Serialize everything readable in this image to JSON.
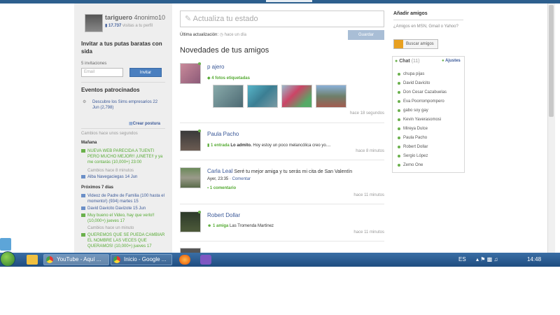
{
  "profile": {
    "name_left": "tariguero",
    "name_right": "4nonimo10",
    "visits_count": "17.737",
    "visits_label": "visitas a tu perfil"
  },
  "invite": {
    "title": "Invitar a tus putas baratas con sida",
    "count": "5 invitaciones",
    "email_placeholder": "Email",
    "button": "Invitar"
  },
  "sponsored": {
    "title": "Eventos patrocinados",
    "item": "Descubre los Sims empresarios 22 Jun (2,798)",
    "create": "Crear postura"
  },
  "changes": {
    "text": "Cambios hace unos segundos"
  },
  "manana": {
    "title": "Mañana",
    "events": [
      {
        "text": "NUEVA WEB PARECIDA A TUENTI PERO MUCHO MEJOR!! ¡UNETE!! y ya me contarás (10,000+) 23:00",
        "color": "green"
      },
      {
        "text": "Cambios hace 8 minutos",
        "color": "muted"
      },
      {
        "text": "Alba Navegaciegas 14 Jun",
        "color": "blue"
      }
    ]
  },
  "proximos": {
    "title": "Próximos 7 días",
    "events": [
      {
        "text": "Videoz de Padre de Familia (100 hasta el momento!) (934) martes 15",
        "color": "blue"
      },
      {
        "text": "David Davicito Davizote 15 Jun",
        "color": "blue"
      },
      {
        "text": "Muy bueno el Video, hay que verlo!! (10,000+) jueves 17",
        "color": "green"
      },
      {
        "text": "Cambios hace un minuto",
        "color": "muted"
      },
      {
        "text": "QUEREMOS QUE SE PUEDA CAMBIAR EL NOMBRE LAS VECES QUE QUERAMOS! (10,000+) jueves 17",
        "color": "green"
      }
    ]
  },
  "status": {
    "placeholder": "Actualiza tu estado",
    "last_label": "Última actualización:",
    "last_time": "hace un día",
    "save": "Guardar"
  },
  "news": {
    "title": "Novedades de tus amigos"
  },
  "posts": [
    {
      "name": "p ajero",
      "action": "4 fotos etiquetadas",
      "time": "hace 18 segundos"
    },
    {
      "name": "Paula Pacho",
      "action": "1 entrada",
      "subject": "Lo admito.",
      "text": "Hoy estoy un poco melancólica creo yo....",
      "time": "hace 8 minutos"
    },
    {
      "name": "Carla Leal",
      "text": "Seré tu mejor amiga y tu serás mi cita de San Valentín",
      "meta_time": "Ayer, 23:35",
      "comment_link": "Comentar",
      "action": "1 comentario",
      "time": "hace 11 minutos"
    },
    {
      "name": "Robert Dollar",
      "action": "1 amiga",
      "text": "Las Tromenda Martinez",
      "time": "hace 11 minutos"
    }
  ],
  "right": {
    "title": "Añadir amigos",
    "question": "¿Amigos en MSN, Gmail o Yahoo?",
    "search_button": "Buscar amigos"
  },
  "chat": {
    "title": "Chat",
    "count": "(11)",
    "settings": "Ajustes",
    "contacts": [
      "chupa pijas",
      "David Davicito",
      "Don Cesar Cazabuelas",
      "Eva Poorrompompero",
      "gabo soy gay",
      "Kevin Yaverasomosi",
      "Mireya Dulce",
      "Paula Pacho",
      "Robert Dollar",
      "Sergio López",
      "Zemo One"
    ]
  },
  "taskbar": {
    "items": [
      "YouTube - Aquí ...",
      "Inicio - Google ..."
    ],
    "lang": "ES",
    "clock": "14:48"
  },
  "colors": {
    "accent": "#3b5998",
    "green": "#55aa33",
    "taskbar": "#2a5d91"
  }
}
